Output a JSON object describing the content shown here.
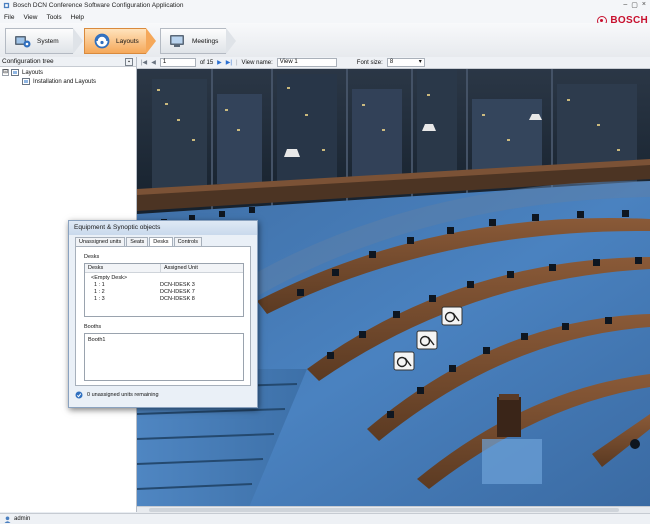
{
  "window": {
    "title": "Bosch DCN Conference Software Configuration Application",
    "controls": {
      "minimize": "–",
      "maximize": "▢",
      "close": "×"
    }
  },
  "menu": [
    "File",
    "View",
    "Tools",
    "Help"
  ],
  "brand": {
    "name": "BOSCH",
    "color": "#c8102e"
  },
  "nav": {
    "items": [
      {
        "label": "System",
        "icon": "system-icon"
      },
      {
        "label": "Layouts",
        "icon": "layouts-icon",
        "active": true
      },
      {
        "label": "Meetings",
        "icon": "meetings-icon"
      }
    ],
    "active_color": "#f5a85a"
  },
  "config_tree": {
    "header": "Configuration tree",
    "items": [
      {
        "label": "Layouts",
        "expander": "⊟"
      },
      {
        "label": "Installation and Layouts"
      }
    ]
  },
  "viewer_toolbar": {
    "page": "1",
    "of": "of 15",
    "view_name_label": "View name:",
    "view_name": "View 1",
    "font_size_label": "Font size:",
    "font_size": "8"
  },
  "dialog": {
    "title": "Equipment & Synoptic objects",
    "tabs": [
      "Unassigned units",
      "Seats",
      "Desks",
      "Controls"
    ],
    "active_tab": "Desks",
    "desks_label": "Desks",
    "desks_columns": [
      "Desks",
      "Assigned Unit"
    ],
    "desks_rows": [
      {
        "desk": "<Empty Desk>",
        "unit": ""
      },
      {
        "desk": "1 : 1",
        "unit": "DCN-IDESK 3"
      },
      {
        "desk": "1 : 2",
        "unit": "DCN-IDESK 7"
      },
      {
        "desk": "1 : 3",
        "unit": "DCN-IDESK 8"
      }
    ],
    "booths_label": "Booths",
    "booths": [
      "Booth1"
    ],
    "remaining": "0 unassigned units remaining"
  },
  "status": {
    "user": "admin"
  }
}
